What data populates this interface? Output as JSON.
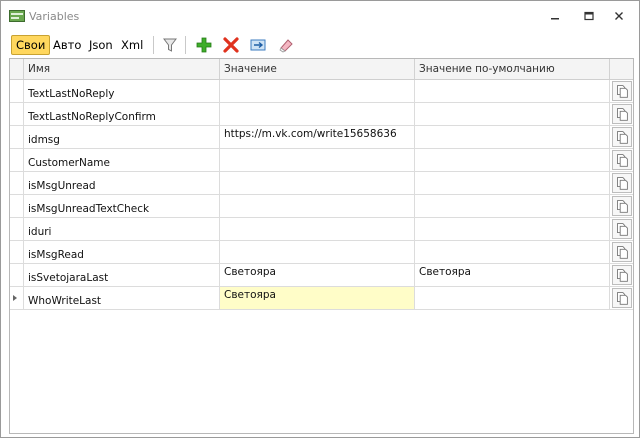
{
  "window": {
    "title": "Variables",
    "icons": {
      "app": "variables-app-icon",
      "minimize": "minimize-icon",
      "maximize": "maximize-icon",
      "close": "close-icon"
    }
  },
  "toolbar": {
    "tabs": [
      "Свои",
      "Авто",
      "Json",
      "Xml"
    ],
    "active_tab": "Свои",
    "actions": [
      "filter-icon",
      "add-icon",
      "delete-icon",
      "move-icon",
      "clear-icon"
    ]
  },
  "grid": {
    "columns": [
      "Имя",
      "Значение",
      "Значение по-умолчанию"
    ],
    "rows": [
      {
        "name": "TextLastNoReply",
        "value": "",
        "default": ""
      },
      {
        "name": "TextLastNoReplyConfirm",
        "value": "",
        "default": ""
      },
      {
        "name": "idmsg",
        "value": "https://m.vk.com/write15658636",
        "default": ""
      },
      {
        "name": "CustomerName",
        "value": "",
        "default": ""
      },
      {
        "name": "isMsgUnread",
        "value": "",
        "default": ""
      },
      {
        "name": "isMsgUnreadTextCheck",
        "value": "",
        "default": ""
      },
      {
        "name": "iduri",
        "value": "",
        "default": ""
      },
      {
        "name": "isMsgRead",
        "value": "",
        "default": ""
      },
      {
        "name": "isSvetojaraLast",
        "value": "Светояра",
        "default": "Светояра"
      },
      {
        "name": "WhoWriteLast",
        "value": "Светояра",
        "default": ""
      }
    ],
    "selected_row": 9,
    "row_action_icon": "copy-icon",
    "colors": {
      "selected_cell": "#fffdc8",
      "active_tab": "#ffd75e"
    }
  }
}
